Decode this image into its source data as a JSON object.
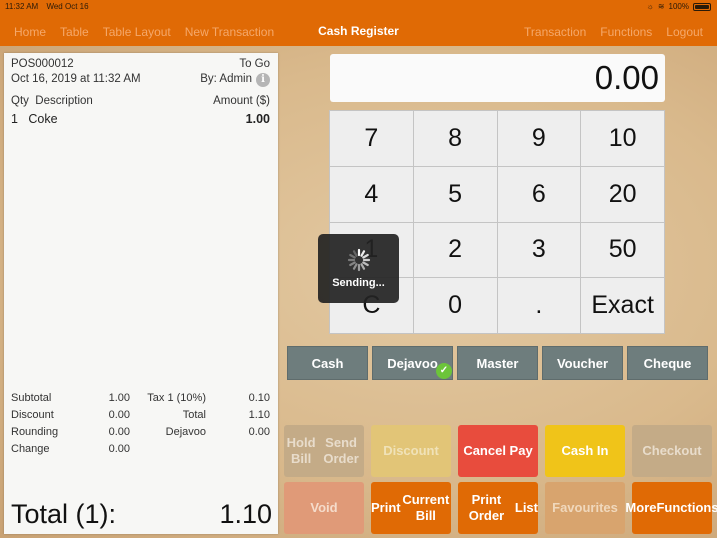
{
  "status_bar": {
    "time": "11:32 AM",
    "date": "Wed Oct 16",
    "battery": "100%"
  },
  "nav": {
    "left": [
      "Home",
      "Table",
      "Table Layout",
      "New Transaction"
    ],
    "title": "Cash Register",
    "right": [
      "Transaction",
      "Functions",
      "Logout"
    ]
  },
  "receipt": {
    "order_no": "POS000012",
    "order_type": "To Go",
    "datetime": "Oct 16, 2019 at 11:32 AM",
    "by": "By: Admin",
    "info_icon": "i",
    "headers": {
      "qty": "Qty",
      "description": "Description",
      "amount": "Amount ($)"
    },
    "items": [
      {
        "qty": "1",
        "description": "Coke",
        "amount": "1.00"
      }
    ],
    "totals": [
      {
        "label": "Subtotal",
        "value": "1.00",
        "label2": "Tax 1 (10%)",
        "value2": "0.10"
      },
      {
        "label": "Discount",
        "value": "0.00",
        "label2": "Total",
        "value2": "1.10"
      },
      {
        "label": "Rounding",
        "value": "0.00",
        "label2": "Dejavoo",
        "value2": "0.00"
      },
      {
        "label": "Change",
        "value": "0.00",
        "label2": "",
        "value2": ""
      }
    ],
    "grand_label": "Total (1):",
    "grand_value": "1.10"
  },
  "display_value": "0.00",
  "keypad": [
    "7",
    "8",
    "9",
    "10",
    "4",
    "5",
    "6",
    "20",
    "1",
    "2",
    "3",
    "50",
    "C",
    "0",
    ".",
    "Exact"
  ],
  "hud": {
    "label": "Sending..."
  },
  "payment_methods": [
    {
      "label": "Cash",
      "selected": false
    },
    {
      "label": "Dejavoo",
      "selected": true
    },
    {
      "label": "Master",
      "selected": false
    },
    {
      "label": "Voucher",
      "selected": false
    },
    {
      "label": "Cheque",
      "selected": false
    }
  ],
  "functions": [
    {
      "label": "Hold Bill\nSend Order",
      "bg": "#c4ab87",
      "fg": "#e8dccb"
    },
    {
      "label": "Discount",
      "bg": "#e2c577",
      "fg": "#f0e2b8"
    },
    {
      "label": "Cancel Pay",
      "bg": "#e84c3d",
      "fg": "#ffffff"
    },
    {
      "label": "Cash In",
      "bg": "#f0c419",
      "fg": "#ffffff"
    },
    {
      "label": "Checkout",
      "bg": "#c4ab87",
      "fg": "#e8dccb"
    },
    {
      "label": "Void",
      "bg": "#e09a78",
      "fg": "#f5dccb"
    },
    {
      "label": "Print\nCurrent Bill",
      "bg": "#e06a05",
      "fg": "#ffffff"
    },
    {
      "label": "Print Order\nList",
      "bg": "#e06a05",
      "fg": "#ffffff"
    },
    {
      "label": "Favourites",
      "bg": "#d8a46e",
      "fg": "#f0d8bc"
    },
    {
      "label": "More\nFunctions",
      "bg": "#e06a05",
      "fg": "#ffffff"
    }
  ],
  "colors": {
    "brand": "#e06a05",
    "pay_button": "#6e7d7d",
    "check": "#6cc43a"
  }
}
